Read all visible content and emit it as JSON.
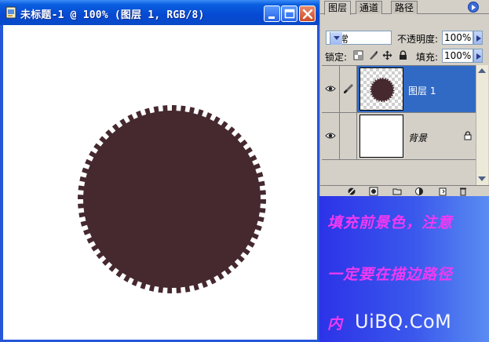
{
  "document": {
    "title": "未标题-1 @ 100% (图层 1, RGB/8)",
    "icons": [
      "photoshop-doc-icon",
      "minimize-icon",
      "maximize-icon",
      "close-icon"
    ],
    "shape_color": "#45292f",
    "shape_outline_color": "#ffffff"
  },
  "layers_panel": {
    "tabs": [
      "图层",
      "通道",
      "路径"
    ],
    "blend_mode": "正常",
    "opacity_label": "不透明度:",
    "opacity_value": "100%",
    "lock_label": "锁定:",
    "fill_label": "填充:",
    "fill_value": "100%",
    "layers": [
      {
        "name": "图层 1",
        "selected": true,
        "visible": true
      },
      {
        "name": "背景",
        "selected": false,
        "visible": true,
        "locked": true
      }
    ],
    "selection_color": "#316ac5"
  },
  "caption": {
    "line1": "填充前景色，注意",
    "line2": "一定要在描边路径",
    "line3": "内",
    "watermark": "UiBQ.CoM",
    "text_color": "#f239f2"
  }
}
